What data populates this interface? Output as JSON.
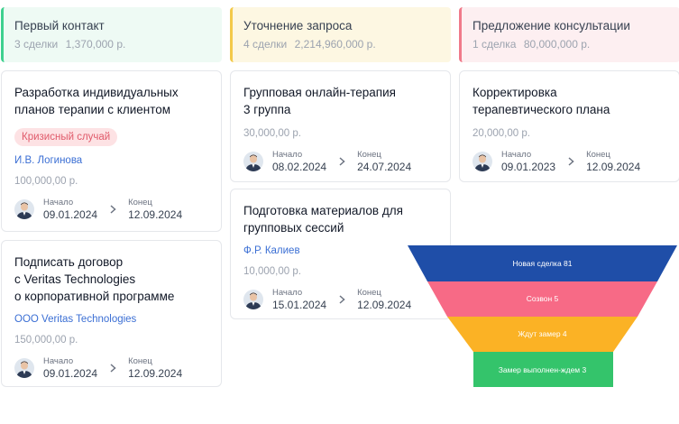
{
  "columns": [
    {
      "title": "Первый контакт",
      "count": "3 сделки",
      "sum": "1,370,000 р.",
      "color": "#3fd08f",
      "bg": "#eefaf4",
      "cards": [
        {
          "title": "Разработка индивидуальных\nпланов терапии с клиентом",
          "tag": "Кризисный случай",
          "person": "И.В. Логинова",
          "amount": "100,000,00 р.",
          "start_label": "Начало",
          "start": "09.01.2024",
          "end_label": "Конец",
          "end": "12.09.2024"
        },
        {
          "title": "Подписать договор\nс Veritas Technologies\nо корпоративной программе",
          "person": "ООО Veritas Technologies",
          "amount": "150,000,00 р.",
          "start_label": "Начало",
          "start": "09.01.2024",
          "end_label": "Конец",
          "end": "12.09.2024"
        }
      ]
    },
    {
      "title": "Уточнение запроса",
      "count": "4 сделки",
      "sum": "2,214,960,000 р.",
      "color": "#f3c94a",
      "bg": "#fdf7e2",
      "cards": [
        {
          "title": "Групповая онлайн-терапия\n3 группа",
          "amount": "30,000,00 р.",
          "start_label": "Начало",
          "start": "08.02.2024",
          "end_label": "Конец",
          "end": "24.07.2024"
        },
        {
          "title": "Подготовка материалов для\nгрупповых сессий",
          "person": "Ф.Р. Калиев",
          "amount": "10,000,00 р.",
          "start_label": "Начало",
          "start": "15.01.2024",
          "end_label": "Конец",
          "end": "12.09.2024"
        }
      ]
    },
    {
      "title": "Предложение консультации",
      "count": "1 сделка",
      "sum": "80,000,000 р.",
      "color": "#f07a8a",
      "bg": "#fdeff1",
      "cards": [
        {
          "title": "Корректировка\nтерапевтического плана",
          "amount": "20,000,00 р.",
          "start_label": "Начало",
          "start": "09.01.2023",
          "end_label": "Конец",
          "end": "12.09.2024"
        }
      ]
    }
  ],
  "funnel": [
    {
      "label": "Новая сделка  81",
      "color": "#1f4ea8"
    },
    {
      "label": "Созвон  5",
      "color": "#f76a86"
    },
    {
      "label": "Ждут замер  4",
      "color": "#fbb225"
    },
    {
      "label": "Замер выполнен-ждем  3",
      "color": "#34c46b"
    }
  ]
}
